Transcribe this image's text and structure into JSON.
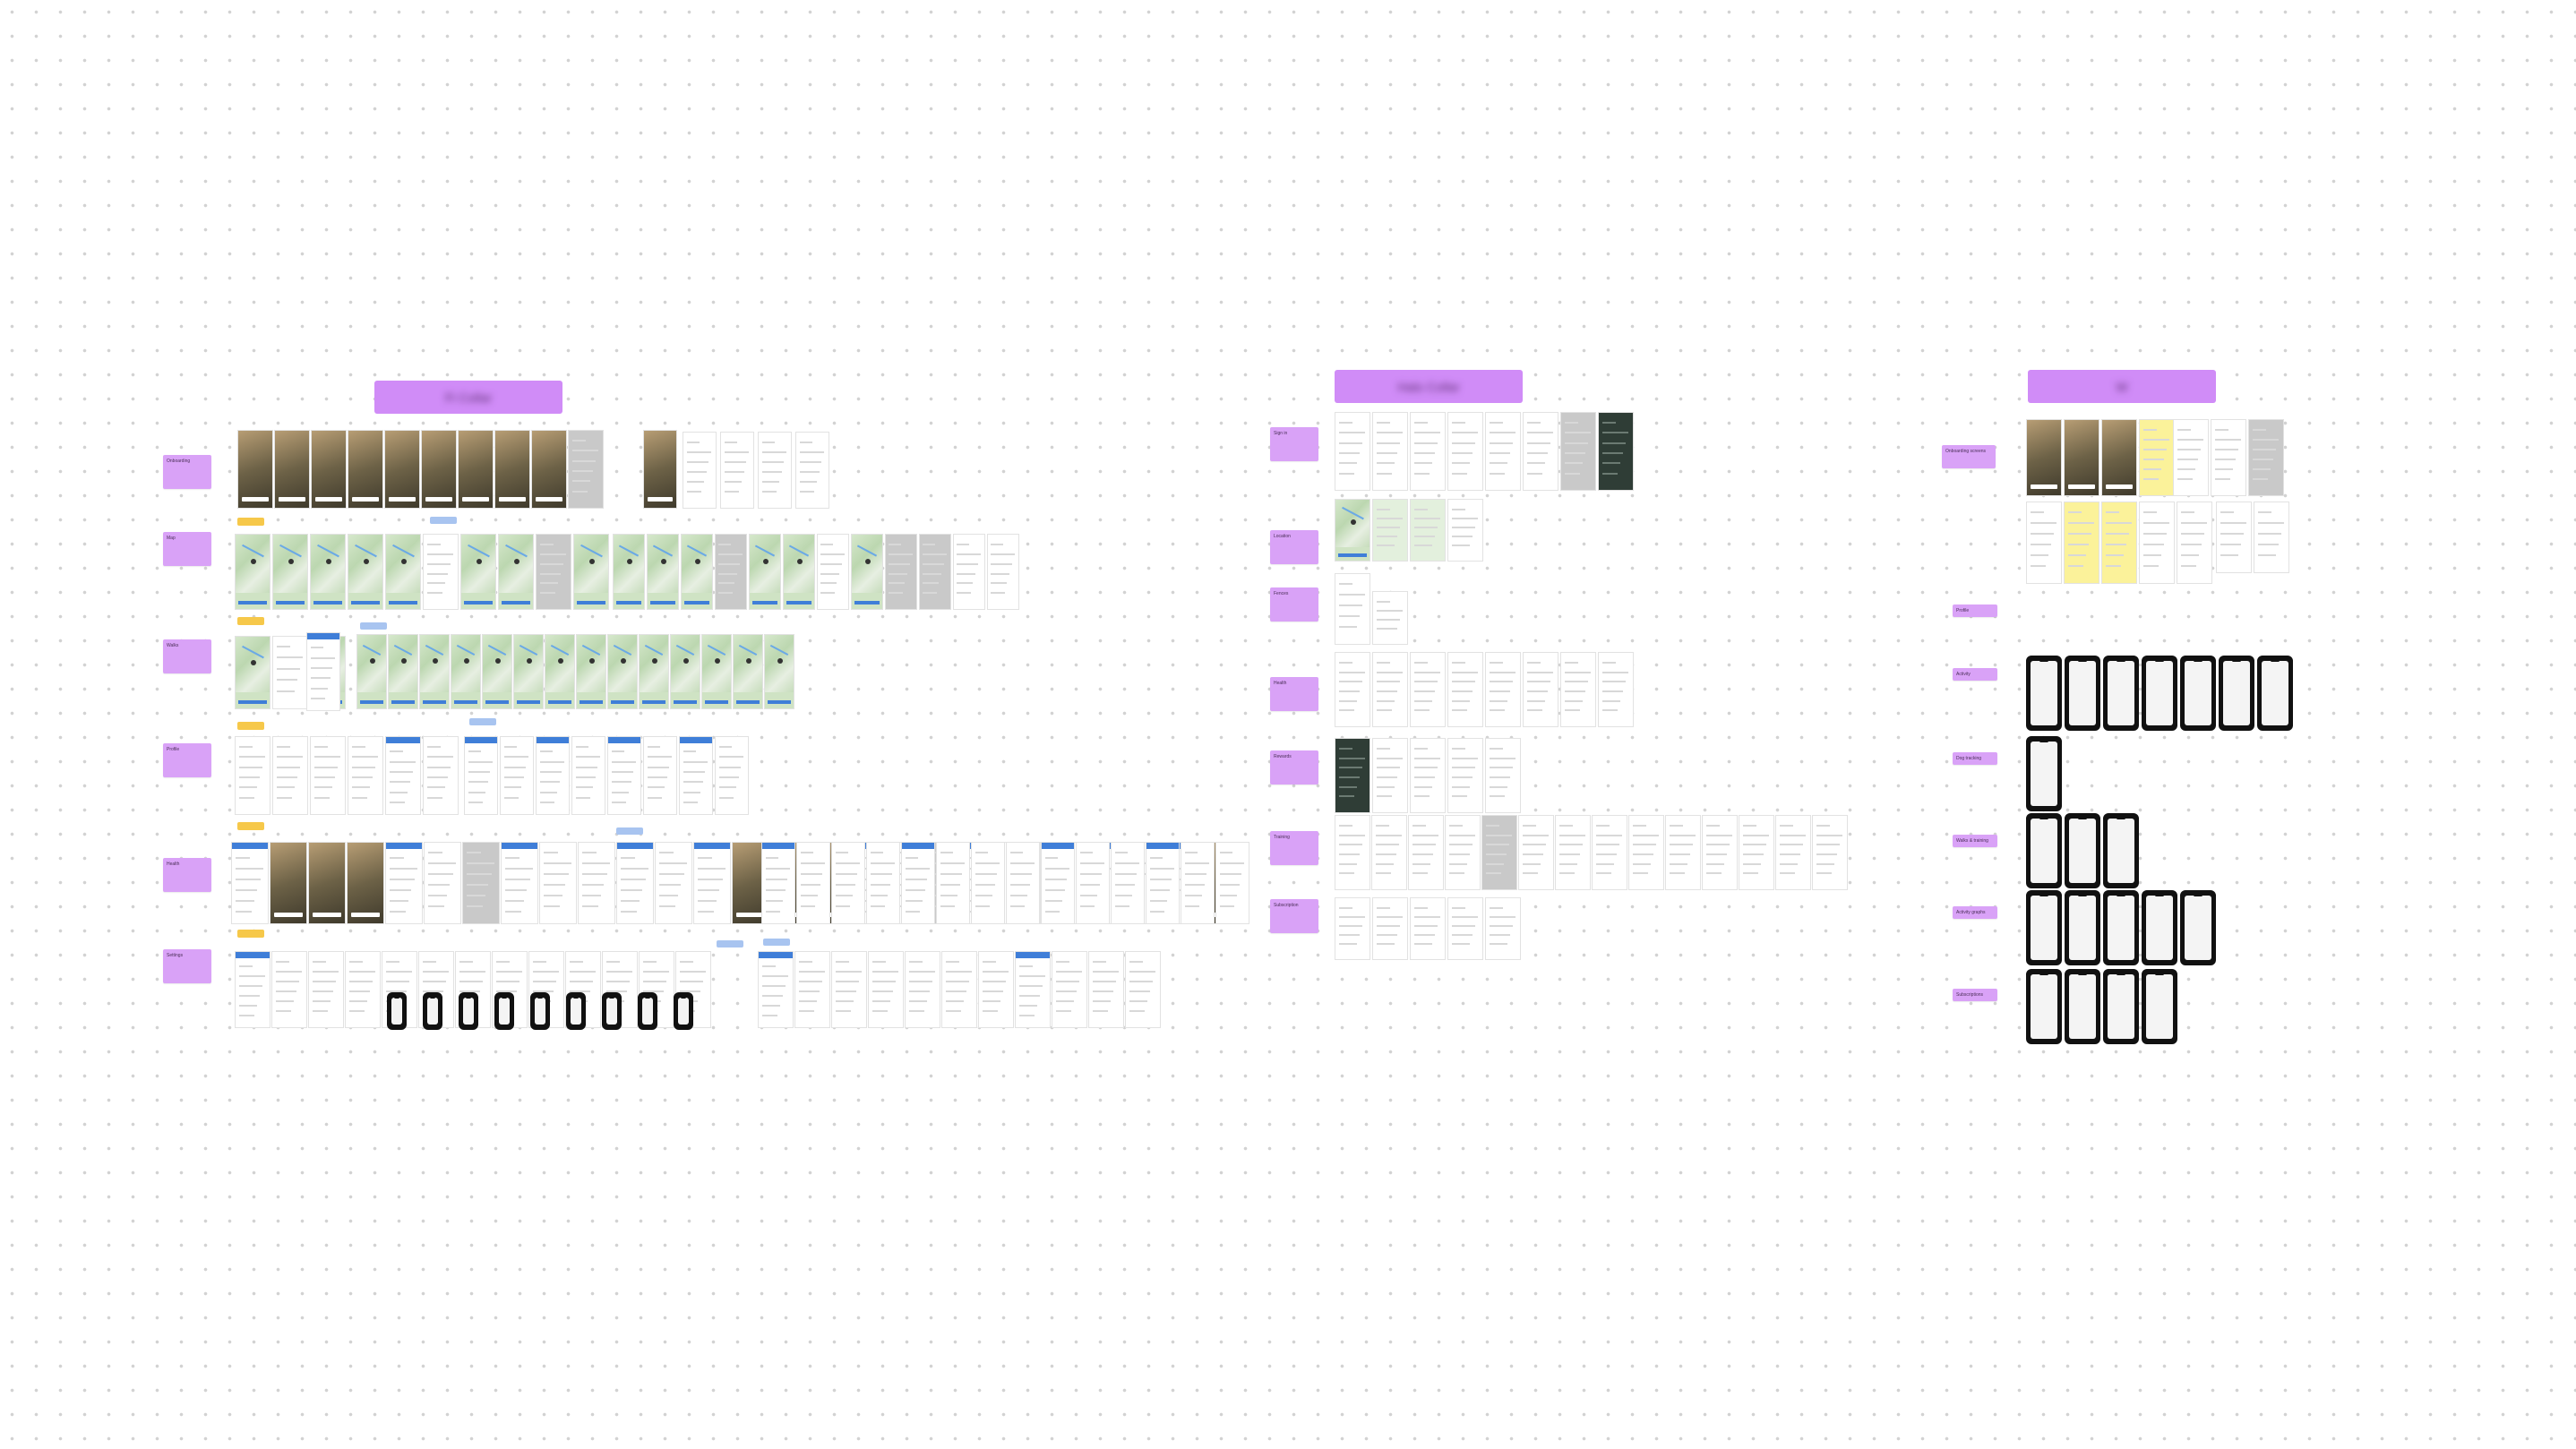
{
  "board": {
    "zoom_label": "",
    "colors": {
      "canvas": "#ffffff",
      "grid_dot": "#d2d2d2",
      "section_title": "#d08cf7",
      "sticky_note": "#d9a2f7",
      "tag_yellow": "#f6c84a",
      "tag_blue": "#a8c4f0",
      "app_blue": "#3f7ed8",
      "app_dark_green": "#2f3d36",
      "app_yellow": "#f6e93a",
      "phone_black": "#111111"
    }
  },
  "sections": [
    {
      "id": "left",
      "title": "Fi Collar",
      "title_blurred": true,
      "row_labels": [
        "Onboarding",
        "Map",
        "Walks",
        "Profile",
        "Health",
        "Settings"
      ],
      "accent": "#3f7ed8"
    },
    {
      "id": "middle",
      "title": "Halo Collar",
      "title_blurred": true,
      "row_labels": [
        "Sign in",
        "Location",
        "Fences",
        "Health",
        "Rewards",
        "Training",
        "Subscription"
      ],
      "accent": "#2f3d36"
    },
    {
      "id": "right",
      "title": "W",
      "title_blurred": true,
      "row_labels": [
        "Onboarding screens",
        "Profile",
        "Activity",
        "Dog tracking",
        "Walks & training",
        "Activity graphs",
        "Subscriptions"
      ],
      "accent": "#f6e93a"
    }
  ],
  "tags": {
    "yellow": [
      "",
      "",
      "",
      "",
      ""
    ],
    "blue": [
      "",
      "",
      "",
      "",
      "",
      ""
    ]
  }
}
